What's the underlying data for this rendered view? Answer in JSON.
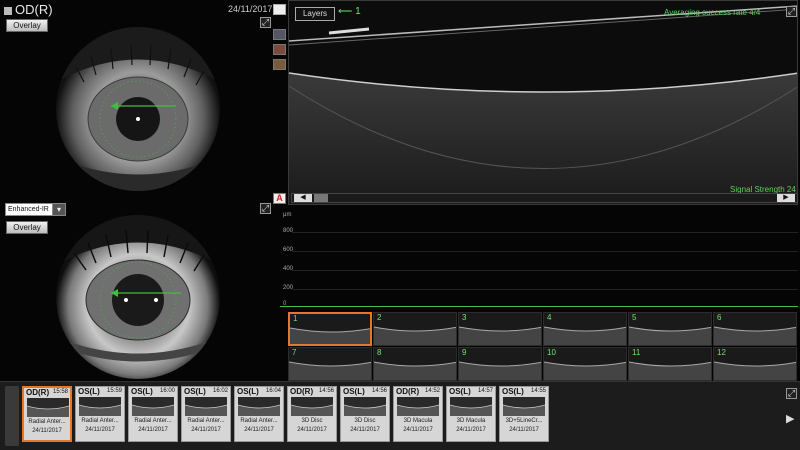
{
  "header": {
    "eye": "OD(R)",
    "date": "24/11/2017"
  },
  "top_photo": {
    "overlay_label": "Overlay"
  },
  "ir_photo": {
    "mode_selected": "Enhanced-IR",
    "overlay_label": "Overlay"
  },
  "oct": {
    "layers_label": "Layers",
    "annotation": "⟵ 1",
    "averaging": "Averaging success rate 4/4",
    "signal_strength": "Signal Strength 24"
  },
  "plot": {
    "unit_label": "μm",
    "ticks": [
      "800",
      "600",
      "400",
      "200",
      "0"
    ]
  },
  "grid": {
    "cells": [
      "1",
      "2",
      "3",
      "4",
      "5",
      "6",
      "7",
      "8",
      "9",
      "10",
      "11",
      "12"
    ],
    "selected": 0
  },
  "tray": {
    "exams": [
      {
        "eye": "OD(R)",
        "time": "15:58",
        "desc": "Radial Anter...",
        "date": "24/11/2017",
        "selected": true
      },
      {
        "eye": "OS(L)",
        "time": "15:59",
        "desc": "Radial Anter...",
        "date": "24/11/2017"
      },
      {
        "eye": "OS(L)",
        "time": "16:00",
        "desc": "Radial Anter...",
        "date": "24/11/2017"
      },
      {
        "eye": "OS(L)",
        "time": "16:02",
        "desc": "Radial Anter...",
        "date": "24/11/2017"
      },
      {
        "eye": "OS(L)",
        "time": "16:04",
        "desc": "Radial Anter...",
        "date": "24/11/2017"
      },
      {
        "eye": "OD(R)",
        "time": "14:56",
        "desc": "3D Disc",
        "date": "24/11/2017"
      },
      {
        "eye": "OS(L)",
        "time": "14:56",
        "desc": "3D Disc",
        "date": "24/11/2017"
      },
      {
        "eye": "OD(R)",
        "time": "14:52",
        "desc": "3D Macula",
        "date": "24/11/2017"
      },
      {
        "eye": "OS(L)",
        "time": "14:57",
        "desc": "3D Macula",
        "date": "24/11/2017"
      },
      {
        "eye": "OS(L)",
        "time": "14:55",
        "desc": "3D+5LineCr...",
        "date": "24/11/2017"
      }
    ]
  },
  "icons": {
    "expand": "expand-icon",
    "layers_tool": "layers-icon",
    "scan_tool": "scan-icon",
    "grid_tool": "grid-icon",
    "annotate": "A"
  },
  "colors": {
    "accent_green": "#5fd05f",
    "selected_orange": "#e07a2a"
  }
}
